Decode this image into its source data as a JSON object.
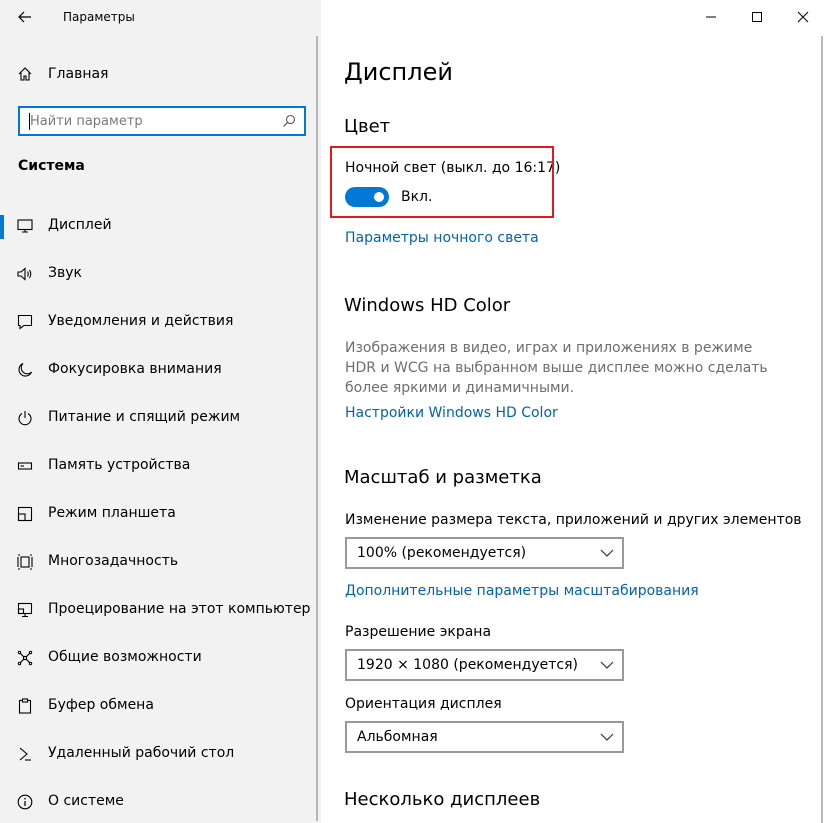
{
  "window": {
    "title": "Параметры"
  },
  "sidebar": {
    "home_label": "Главная",
    "search_placeholder": "Найти параметр",
    "section_title": "Система",
    "items": [
      {
        "label": "Дисплей",
        "icon": "monitor-icon",
        "active": true
      },
      {
        "label": "Звук",
        "icon": "speaker-icon"
      },
      {
        "label": "Уведомления и действия",
        "icon": "notification-icon"
      },
      {
        "label": "Фокусировка внимания",
        "icon": "moon-icon"
      },
      {
        "label": "Питание и спящий режим",
        "icon": "power-icon"
      },
      {
        "label": "Память устройства",
        "icon": "storage-icon"
      },
      {
        "label": "Режим планшета",
        "icon": "tablet-icon"
      },
      {
        "label": "Многозадачность",
        "icon": "multitask-icon"
      },
      {
        "label": "Проецирование на этот компьютер",
        "icon": "projector-icon"
      },
      {
        "label": "Общие возможности",
        "icon": "share-icon"
      },
      {
        "label": "Буфер обмена",
        "icon": "clipboard-icon"
      },
      {
        "label": "Удаленный рабочий стол",
        "icon": "remote-icon"
      },
      {
        "label": "О системе",
        "icon": "info-icon"
      }
    ]
  },
  "main": {
    "title": "Дисплей",
    "color_heading": "Цвет",
    "night_light_label": "Ночной свет (выкл. до 16:17)",
    "night_light_toggle_label": "Вкл.",
    "night_light_toggle_on": true,
    "night_light_settings_link": "Параметры ночного света",
    "hdr_heading": "Windows HD Color",
    "hdr_description": "Изображения в видео, играх и приложениях в режиме HDR и WCG на выбранном выше дисплее можно сделать более яркими и динамичными.",
    "hdr_settings_link": "Настройки Windows HD Color",
    "scale_heading": "Масштаб и разметка",
    "scale_label": "Изменение размера текста, приложений и других элементов",
    "scale_value": "100% (рекомендуется)",
    "advanced_scale_link": "Дополнительные параметры масштабирования",
    "resolution_label": "Разрешение экрана",
    "resolution_value": "1920 × 1080 (рекомендуется)",
    "orientation_label": "Ориентация дисплея",
    "orientation_value": "Альбомная",
    "multi_display_heading": "Несколько дисплеев"
  },
  "colors": {
    "accent": "#0078d7",
    "link": "#0063b1",
    "highlight_border": "#e11b1b",
    "sidebar_bg": "#f2f2f2"
  }
}
